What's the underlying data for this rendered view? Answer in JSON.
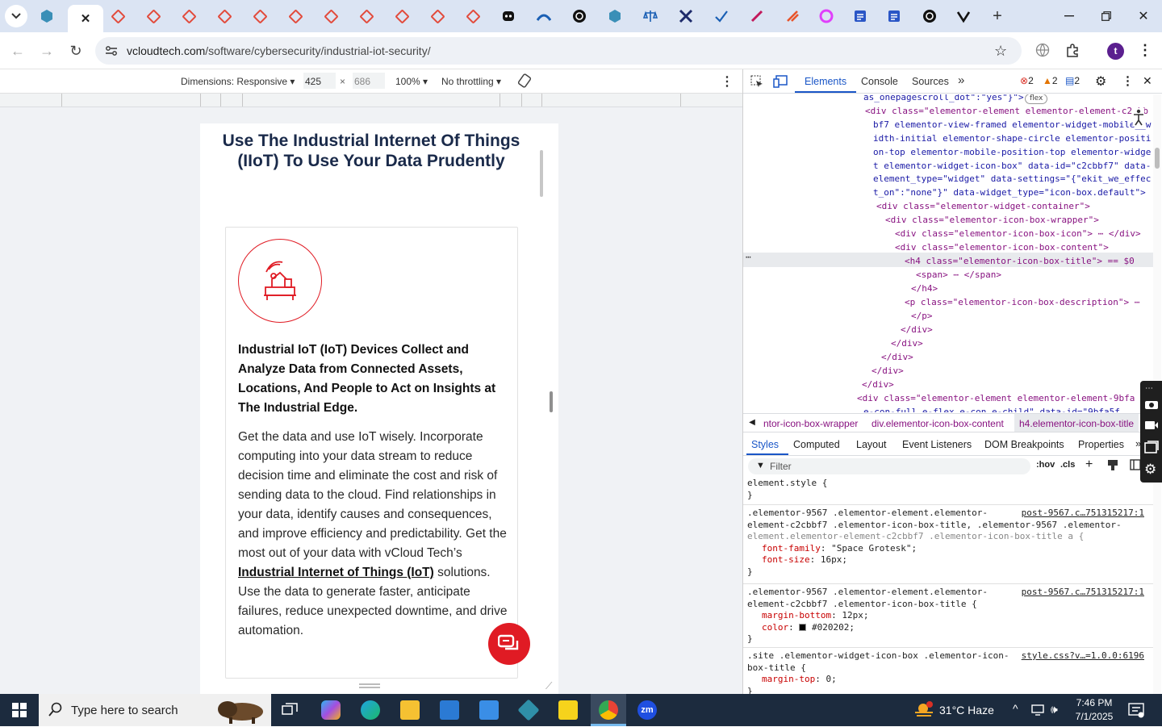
{
  "browser": {
    "url_domain": "vcloudtech.com",
    "url_path": "/software/cybersecurity/industrial-iot-security/",
    "profile_initial": "t"
  },
  "device_toolbar": {
    "dimensions_label": "Dimensions: Responsive",
    "width": "425",
    "height": "686",
    "zoom": "100%",
    "throttle": "No throttling"
  },
  "page": {
    "heading": "Use The Industrial Internet Of Things (IIoT) To Use Your Data Prudently",
    "card_title": "Industrial IoT (IoT) Devices Collect and Analyze Data from Connected Assets, Locations, And People to Act on Insights at The Industrial Edge.",
    "card_desc_before": "Get the data and use IoT wisely. Incorporate computing into your data stream to reduce decision time and eliminate the cost and risk of sending data to the cloud. Find relationships in your data, identify causes and consequences, and improve efficiency and predictability. Get the most out of your data with vCloud Tech’s ",
    "card_desc_link": "Industrial Internet of Things (IoT)",
    "card_desc_after": " solutions. Use the data to generate faster, anticipate failures, reduce unexpected downtime, and drive automation."
  },
  "devtools": {
    "tabs": [
      "Elements",
      "Console",
      "Sources"
    ],
    "errors": "2",
    "warnings": "2",
    "issues": "2",
    "dom_lines": [
      "as_onepagescroll_dot\":\"yes\"}\">",
      "<div class=\"elementor-element elementor-element-c2cbb",
      "bf7 elementor-view-framed elementor-widget-mobile__w",
      "idth-initial elementor-shape-circle elementor-positi",
      "on-top elementor-mobile-position-top elementor-widge",
      "t elementor-widget-icon-box\" data-id=\"c2cbbf7\" data-",
      "element_type=\"widget\" data-settings=\"{\"ekit_we_effec",
      "t_on\":\"none\"}\" data-widget_type=\"icon-box.default\">",
      "<div class=\"elementor-widget-container\">",
      "<div class=\"elementor-icon-box-wrapper\">",
      "<div class=\"elementor-icon-box-icon\"> ⋯ </div>",
      "<div class=\"elementor-icon-box-content\">",
      "<h4 class=\"elementor-icon-box-title\"> == $0",
      "<span> ⋯ </span>",
      "</h4>",
      "<p class=\"elementor-icon-box-description\"> ⋯",
      "</p>",
      "</div>",
      "</div>",
      "</div>",
      "</div>",
      "</div>",
      "<div class=\"elementor-element elementor-element-9bfa",
      "e-con-full e-flex e-con e-child\" data-id=\"9bfa5f"
    ],
    "flex_badge": "flex",
    "breadcrumbs": [
      "ntor-icon-box-wrapper",
      "div.elementor-icon-box-content",
      "h4.elementor-icon-box-title"
    ],
    "style_tabs": [
      "Styles",
      "Computed",
      "Layout",
      "Event Listeners",
      "DOM Breakpoints",
      "Properties"
    ],
    "filter_placeholder": "Filter",
    "hov": ":hov",
    "cls": ".cls",
    "rules": {
      "r0_sel": "element.style {",
      "r0_close": "}",
      "r1_sel1": ".elementor-9567 .elementor-element.elementor-",
      "r1_sel2": "element-c2cbbf7 .elementor-icon-box-title, .elementor-9567 .elementor-",
      "r1_sel3": "element.elementor-element-c2cbbf7 .elementor-icon-box-title a {",
      "r1_src": "post-9567.c…751315217:1",
      "r1_p1": "font-family",
      "r1_v1": "\"Space Grotesk\";",
      "r1_p2": "font-size",
      "r1_v2": "16px;",
      "r2_sel1": ".elementor-9567 .elementor-element.elementor-",
      "r2_sel2": "element-c2cbbf7 .elementor-icon-box-title {",
      "r2_src": "post-9567.c…751315217:1",
      "r2_p1": "margin-bottom",
      "r2_v1": "12px;",
      "r2_p2": "color",
      "r2_v2": "#020202;",
      "r3_sel1": ".site .elementor-widget-icon-box .elementor-icon-",
      "r3_sel2": "box-title {",
      "r3_src": "style.css?v…=1.0.0:6196",
      "r3_p1": "margin-top",
      "r3_v1": "0;"
    }
  },
  "taskbar": {
    "search_placeholder": "Type here to search",
    "weather": "31°C  Haze",
    "time": "7:46 PM",
    "date": "7/1/2025"
  },
  "colors": {
    "accent": "#e01b24",
    "devtools_blue": "#1a56c7"
  }
}
